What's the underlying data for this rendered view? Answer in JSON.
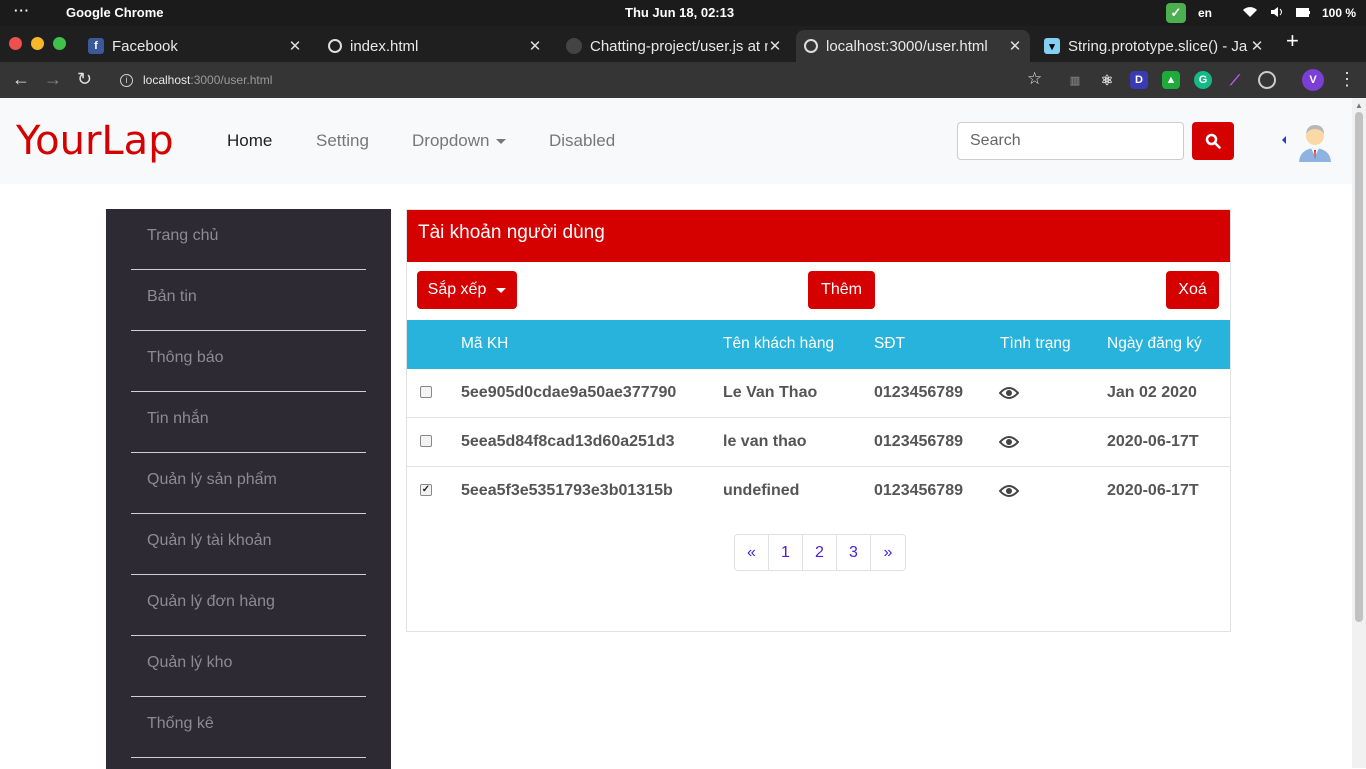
{
  "system": {
    "app_name": "Google Chrome",
    "clock": "Thu Jun 18, 02:13",
    "language": "en",
    "battery": "100 %"
  },
  "tabs": [
    {
      "title": "Facebook",
      "icon": "facebook-icon"
    },
    {
      "title": "index.html",
      "icon": "globe-icon"
    },
    {
      "title": "Chatting-project/user.js at m",
      "icon": "github-icon"
    },
    {
      "title": "localhost:3000/user.html",
      "icon": "globe-icon"
    },
    {
      "title": "String.prototype.slice() - Ja",
      "icon": "mdn-icon"
    }
  ],
  "address": {
    "url_host": "localhost",
    "url_rest": ":3000/user.html"
  },
  "extensions": [
    "D",
    "G",
    "V"
  ],
  "navbar": {
    "brand": "YourLap",
    "links": [
      "Home",
      "Setting",
      "Dropdown",
      "Disabled"
    ],
    "search_placeholder": "Search"
  },
  "sidebar": {
    "items": [
      "Trang chủ",
      "Bản tin",
      "Thông báo",
      "Tin nhắn",
      "Quản lý sản phẩm",
      "Quản lý tài khoản",
      "Quản lý đơn hàng",
      "Quản lý kho",
      "Thống kê"
    ]
  },
  "card": {
    "title": "Tài khoản người dùng",
    "sort_label": "Sắp xếp",
    "add_label": "Thêm",
    "delete_label": "Xoá"
  },
  "table": {
    "headers": [
      "Mã KH",
      "Tên khách hàng",
      "SĐT",
      "Tình trạng",
      "Ngày đăng ký"
    ],
    "rows": [
      {
        "checked": false,
        "id": "5ee905d0cdae9a50ae377790",
        "name": "Le Van Thao",
        "phone": "0123456789",
        "date": "Jan 02 2020"
      },
      {
        "checked": false,
        "id": "5eea5d84f8cad13d60a251d3",
        "name": "le van thao",
        "phone": "0123456789",
        "date": "2020-06-17T"
      },
      {
        "checked": true,
        "id": "5eea5f3e5351793e3b01315b",
        "name": "undefined",
        "phone": "0123456789",
        "date": "2020-06-17T"
      }
    ]
  },
  "pagination": [
    "«",
    "1",
    "2",
    "3",
    "»"
  ],
  "colors": {
    "brand": "#d50000",
    "table_header": "#27b3db",
    "sidebar": "#2d2a33"
  }
}
